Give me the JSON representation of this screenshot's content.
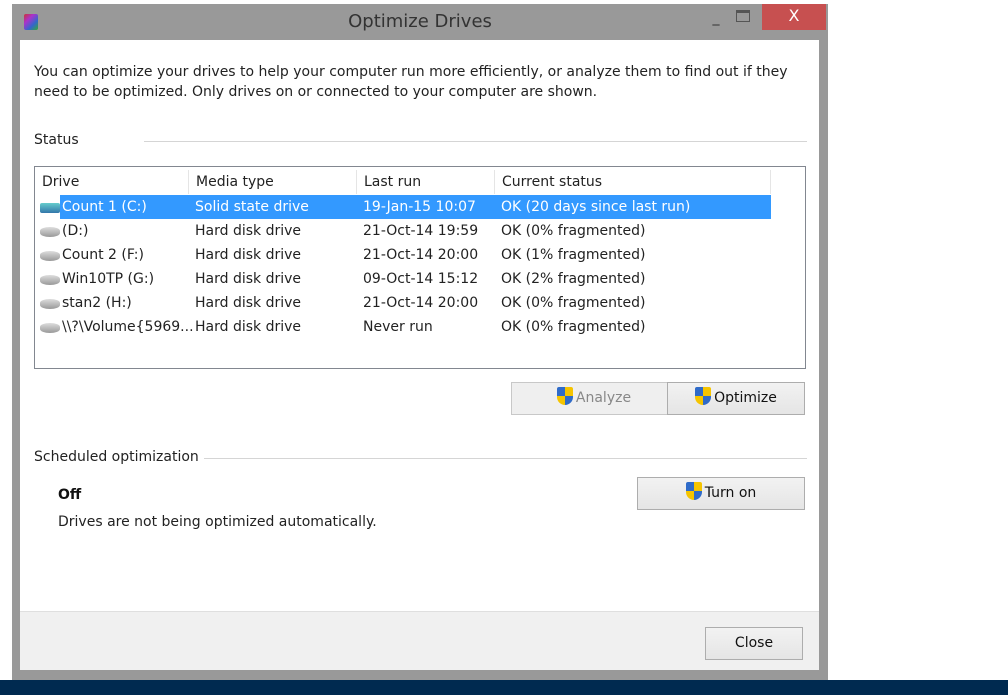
{
  "window": {
    "title": "Optimize Drives",
    "minimize": "_",
    "close": "X"
  },
  "intro": "You can optimize your drives to help your computer run more efficiently, or analyze them to find out if they need to be optimized. Only drives on or connected to your computer are shown.",
  "status": {
    "label": "Status",
    "columns": [
      "Drive",
      "Media type",
      "Last run",
      "Current status"
    ],
    "rows": [
      {
        "drive": "Count 1 (C:)",
        "media": "Solid state drive",
        "last": "19-Jan-15 10:07",
        "status": "OK (20 days since last run)",
        "icon": "ssd-icon",
        "selected": true
      },
      {
        "drive": "(D:)",
        "media": "Hard disk drive",
        "last": "21-Oct-14 19:59",
        "status": "OK (0% fragmented)",
        "icon": "hdd-icon"
      },
      {
        "drive": "Count 2 (F:)",
        "media": "Hard disk drive",
        "last": "21-Oct-14 20:00",
        "status": "OK (1% fragmented)",
        "icon": "hdd-icon"
      },
      {
        "drive": "Win10TP (G:)",
        "media": "Hard disk drive",
        "last": "09-Oct-14 15:12",
        "status": "OK (2% fragmented)",
        "icon": "hdd-icon"
      },
      {
        "drive": "stan2 (H:)",
        "media": "Hard disk drive",
        "last": "21-Oct-14 20:00",
        "status": "OK (0% fragmented)",
        "icon": "hdd-icon"
      },
      {
        "drive": "\\\\?\\Volume{5969...",
        "media": "Hard disk drive",
        "last": "Never run",
        "status": "OK (0% fragmented)",
        "icon": "hdd-icon"
      }
    ],
    "analyze": "Analyze",
    "optimize": "Optimize"
  },
  "scheduled": {
    "label": "Scheduled optimization",
    "state": "Off",
    "description": "Drives are not being optimized automatically.",
    "turn_on": "Turn on"
  },
  "footer": {
    "close": "Close"
  },
  "colors": {
    "selection": "#3399ff",
    "close_button": "#c75050",
    "title_bar": "#999999"
  }
}
